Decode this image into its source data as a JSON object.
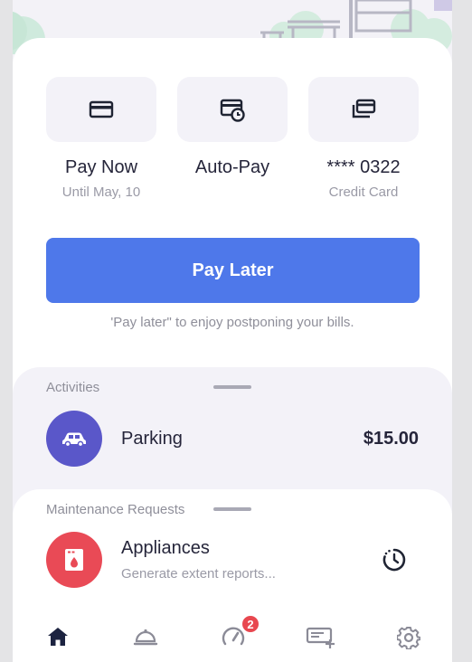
{
  "actions": [
    {
      "label": "Pay Now",
      "sub": "Until May, 10",
      "icon": "card-icon"
    },
    {
      "label": "Auto-Pay",
      "sub": "",
      "icon": "card-clock-icon"
    },
    {
      "label": "**** 0322",
      "sub": "Credit Card",
      "icon": "cards-stack-icon"
    }
  ],
  "pay_later": {
    "label": "Pay Later",
    "hint": "'Pay later\" to enjoy postponing your bills."
  },
  "activities": {
    "title": "Activities",
    "items": [
      {
        "name": "Parking",
        "amount": "$15.00",
        "icon": "car-icon",
        "color": "#5a57c9"
      }
    ]
  },
  "maintenance": {
    "title": "Maintenance Requests",
    "items": [
      {
        "name": "Appliances",
        "sub": "Generate extent reports...",
        "icon": "washing-machine-icon",
        "color": "#e94a56",
        "status_icon": "pending-clock-icon"
      }
    ]
  },
  "nav": {
    "items": [
      "home-icon",
      "service-bell-icon",
      "speedometer-icon",
      "add-request-icon",
      "gear-icon"
    ],
    "badge_count": "2",
    "active_color": "#1c2340"
  }
}
